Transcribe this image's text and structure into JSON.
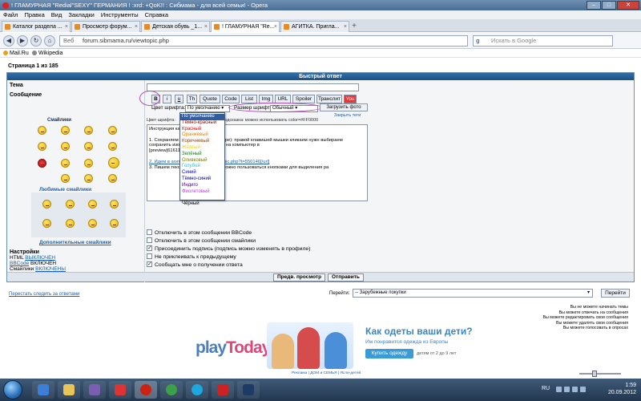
{
  "window": {
    "title": "! ГЛАМУРНАЯ \"Redial\"SEXY\" ГЕРМАНИЯ ! :xrd: +QoK!! : Сибмама - для всей семьи! - Opera"
  },
  "menu": [
    "Файл",
    "Правка",
    "Вид",
    "Закладки",
    "Инструменты",
    "Справка"
  ],
  "tabs": [
    {
      "label": "Каталог раздела ..."
    },
    {
      "label": "Просмотр форум..."
    },
    {
      "label": "Детская обувь _1..."
    },
    {
      "label": "! ГЛАМУРНАЯ \"Re...",
      "active": true
    },
    {
      "label": "АГИТКА. Пригла..."
    }
  ],
  "address": {
    "prefix": "Веб",
    "url": "forum.sibmama.ru/viewtopic.php"
  },
  "search": {
    "placeholder": "Искать в Google"
  },
  "bookmarks": [
    "Mail.Ru",
    "Wikipedia"
  ],
  "page": {
    "pagenum": "Страница 1 из 185",
    "panel_title": "Быстрый ответ",
    "topic_label": "Тема",
    "message_label": "Сообщение",
    "smiles_label": "Смайлики",
    "fav_smiles": "Любимые смайлики",
    "more_smiles": "Дополнительные смайлики",
    "toolbar": [
      "B",
      "i",
      "u",
      "Th",
      "Quote",
      "Code",
      "List",
      "Img",
      "URL",
      "Spoiler",
      "Транслит",
      "You"
    ],
    "font_color_label": "Цвет шрифта:",
    "font_color_value": "По умолчанию",
    "font_size_label": "Размер шрифта:",
    "font_size_value": "Обычный",
    "upload_button": "Загрузить фото",
    "close_tips": "Закрыть теги",
    "color_hint_prefix": "Цвет шрифта:",
    "color_hint": "Подсказка: можно использовать color=#FF0000",
    "message_text": [
      "Инструкция как",
      "1. Сохраняем                е ( я сохраняю в Опере): правой клавишей мышки кликаем нужн                выбираем сохранить изображение. Сохранен на компьютер в               ",
      "[preview]616110                [/preview]",
      "2. Идем в агитк              .sibmama.ru/viewtopic.php?t=550146[/url]",
      "3. Пишем текст              ирить ряды и т.п. Можно пользоваться кнопками для выделения ра             "
    ],
    "color_options": [
      "По умолчанию",
      "Тёмно-красный",
      "Красный",
      "Оранжевый",
      "Коричневый",
      "Жёлтый",
      "Зелёный",
      "Оливковый",
      "Голубой",
      "Синий",
      "Тёмно-синий",
      "Индиго",
      "Фиолетовый",
      "Белый",
      "Чёрный"
    ],
    "settings_title": "Настройки",
    "settings_lines": [
      {
        "label": "HTML",
        "value": "ВЫКЛЮЧЕН"
      },
      {
        "label": "BBCode",
        "value": "ВКЛЮЧЕН"
      },
      {
        "label": "Смайлики",
        "value": "ВКЛЮЧЕНЫ"
      }
    ],
    "checkboxes": [
      {
        "label": "Отключить в этом сообщении BBCode",
        "checked": false
      },
      {
        "label": "Отключить в этом сообщении смайлики",
        "checked": false
      },
      {
        "label": "Присоединить подпись (подпись можно изменять в профиле)",
        "checked": true
      },
      {
        "label": "Не приклеивать к предыдущему",
        "checked": false
      },
      {
        "label": "Сообщать мне о получении ответа",
        "checked": true
      }
    ],
    "preview_button": "Предв. просмотр",
    "send_button": "Отправить",
    "read_all": "Перестать следить за ответами",
    "jump_label": "Перейти:",
    "jump_value": "-- Зарубежные покупки",
    "go_button": "Перейти",
    "permissions": [
      "Вы не можете начинать темы",
      "Вы можете отвечать на сообщения",
      "Вы можете редактировать свои сообщения",
      "Вы можете удалять свои сообщения",
      "Вы можете голосовать в опросах"
    ]
  },
  "banner": {
    "logo_a": "play",
    "logo_b": "Today",
    "title": "Как одеты ваши дети?",
    "subtitle": "Им понравится одежда из Европы",
    "button": "Купить одежду",
    "age": "детям от 2 до 9 лет",
    "links": "Реклама | ДОМ и СЕМЬЯ | Ясли-детей"
  },
  "taskbar": {
    "lang": "RU",
    "time": "1:59",
    "date": "20.09.2012"
  },
  "colors": {
    "panel_header": "#1d5187",
    "highlight_ring": "#b04ab4",
    "link": "#1c5fb0"
  }
}
